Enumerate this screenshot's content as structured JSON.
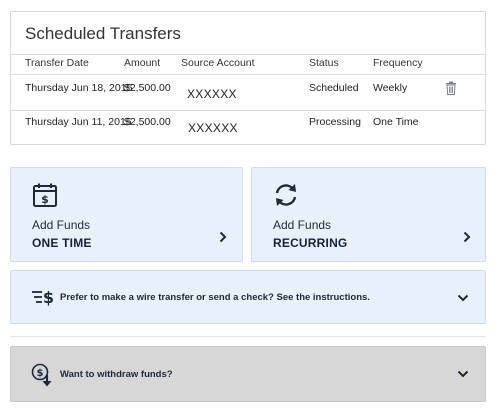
{
  "scheduled": {
    "title": "Scheduled Transfers",
    "columns": [
      "Transfer Date",
      "Amount",
      "Source Account",
      "Status",
      "Frequency"
    ],
    "rows": [
      {
        "date": "Thursday Jun 18, 2015",
        "amount": "$2,500.00",
        "source": "XXXXXX",
        "status": "Scheduled",
        "frequency": "Weekly"
      },
      {
        "date": "Thursday Jun 11, 2015",
        "amount": "$2,500.00",
        "source": "XXXXXX",
        "status": "Processing",
        "frequency": "One Time"
      }
    ]
  },
  "add_one_time": {
    "title": "Add Funds",
    "subtitle": "ONE TIME"
  },
  "add_recurring": {
    "title": "Add Funds",
    "subtitle": "RECURRING"
  },
  "wire": {
    "text": "Prefer to make a wire transfer or send a check? See the instructions."
  },
  "withdraw": {
    "text": "Want to withdraw funds?"
  },
  "colors": {
    "panel_bg": "#e8f0fb",
    "withdraw_bg": "#d7d7d7",
    "icon": "#1c2a3d"
  },
  "icons": [
    "calendar-dollar-icon",
    "recurring-arrows-icon",
    "trash-icon",
    "chevron-right-icon",
    "wire-transfer-icon",
    "withdraw-funds-icon",
    "chevron-down-icon"
  ]
}
